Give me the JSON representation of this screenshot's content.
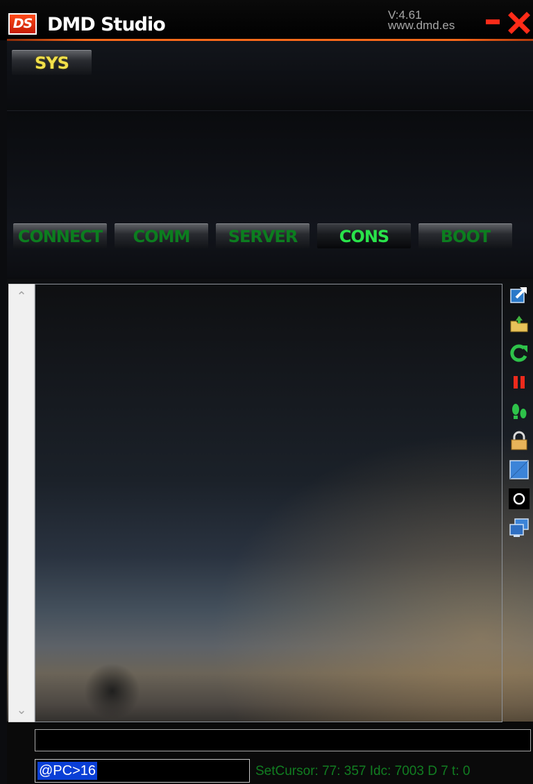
{
  "window": {
    "logo_text": "DS",
    "title": "DMD Studio",
    "version": "V:4.61",
    "website": "www.dmd.es"
  },
  "header": {
    "sys_label": "SYS"
  },
  "tabs": [
    {
      "label": "CONNECT",
      "active": false
    },
    {
      "label": "COMM",
      "active": false
    },
    {
      "label": "SERVER",
      "active": false
    },
    {
      "label": "CONS",
      "active": true
    },
    {
      "label": "BOOT",
      "active": false
    }
  ],
  "console": {
    "output_text": "",
    "command_value": "",
    "prompt": "@PC>16",
    "status": "SetCursor:  77: 357 Idc: 7003 D 7 t: 0"
  },
  "toolbar_icons": [
    "external-link-icon",
    "open-folder-icon",
    "refresh-icon",
    "pause-icon",
    "footsteps-icon",
    "lock-icon",
    "blue-square-icon",
    "circle-icon",
    "windows-icon"
  ],
  "colors": {
    "accent_orange": "#ff6a1a",
    "close_red": "#ff2b18",
    "sys_yellow": "#f2e04a",
    "tab_green_inactive": "#0c7d1f",
    "tab_green_active": "#29e34a",
    "status_green": "#117d21",
    "prompt_selection": "#0a3fd6"
  }
}
